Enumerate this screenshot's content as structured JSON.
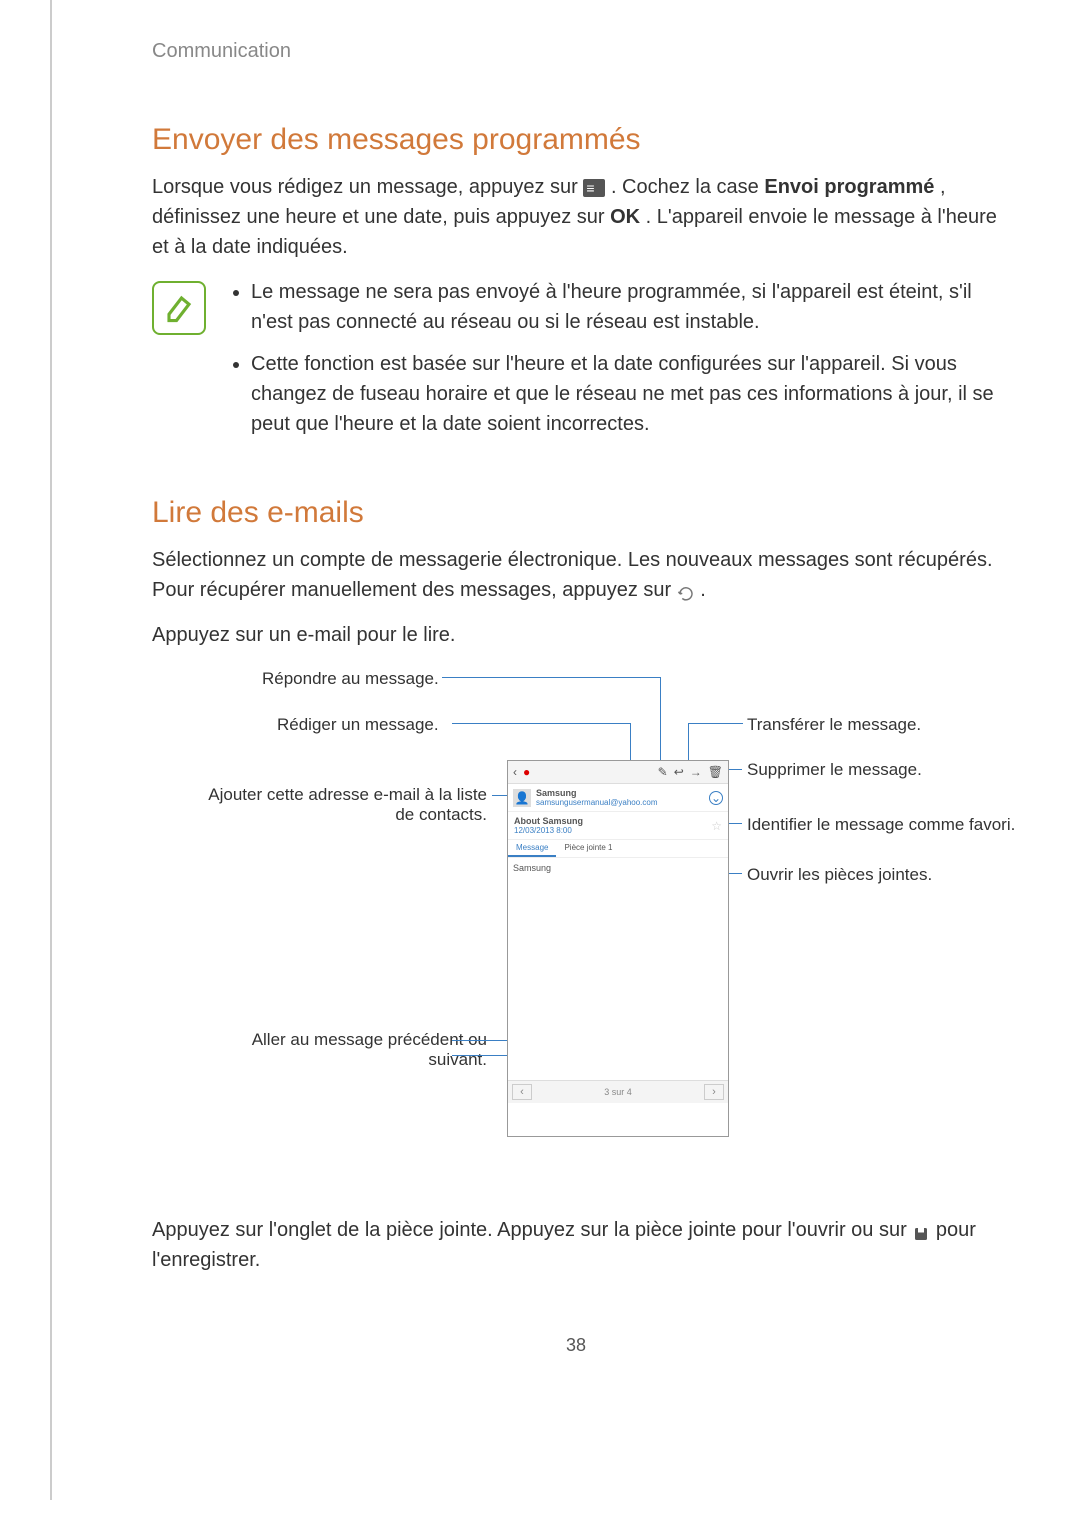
{
  "header": "Communication",
  "section1": {
    "title": "Envoyer des messages programmés",
    "para_pre": "Lorsque vous rédigez un message, appuyez sur ",
    "para_mid1": ". Cochez la case ",
    "bold1": "Envoi programmé",
    "para_mid2": ", définissez une heure et une date, puis appuyez sur ",
    "bold2": "OK",
    "para_post": ". L'appareil envoie le message à l'heure et à la date indiquées.",
    "note1": "Le message ne sera pas envoyé à l'heure programmée, si l'appareil est éteint, s'il n'est pas connecté au réseau ou si le réseau est instable.",
    "note2": "Cette fonction est basée sur l'heure et la date configurées sur l'appareil. Si vous changez de fuseau horaire et que le réseau ne met pas ces informations à jour, il se peut que l'heure et la date soient incorrectes."
  },
  "section2": {
    "title": "Lire des e-mails",
    "para3_pre": "Sélectionnez un compte de messagerie électronique. Les nouveaux messages sont récupérés. Pour récupérer manuellement des messages, appuyez sur ",
    "para3_post": ".",
    "para4": "Appuyez sur un e-mail pour le lire."
  },
  "diagram": {
    "callouts": {
      "reply": "Répondre au message.",
      "compose": "Rédiger un message.",
      "forward": "Transférer le message.",
      "delete": "Supprimer le message.",
      "addContact": "Ajouter cette adresse e-mail à la liste de contacts.",
      "favorite": "Identifier le message comme favori.",
      "attachments": "Ouvrir les pièces jointes.",
      "navigate": "Aller au message précédent ou suivant."
    },
    "phone": {
      "senderName": "Samsung",
      "senderEmail": "samsungusermanual@yahoo.com",
      "subject": "About Samsung",
      "date": "12/03/2013 8:00",
      "tabMessage": "Message",
      "tabAttachment": "Pièce jointe 1",
      "bodyText": "Samsung",
      "footerCount": "3 sur 4"
    }
  },
  "para5_pre": "Appuyez sur l'onglet de la pièce jointe. Appuyez sur la pièce jointe pour l'ouvrir ou sur ",
  "para5_post": " pour l'enregistrer.",
  "pageNum": "38"
}
